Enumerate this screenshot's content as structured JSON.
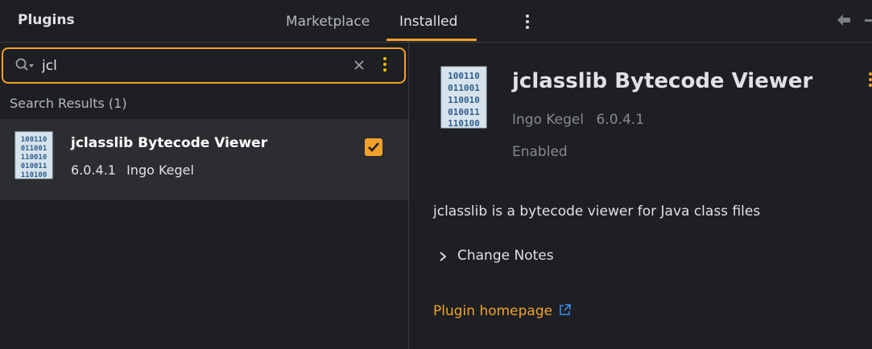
{
  "window": {
    "title": "Plugins"
  },
  "tabs": [
    {
      "label": "Marketplace",
      "active": false
    },
    {
      "label": "Installed",
      "active": true
    }
  ],
  "icons": {
    "options": "more-vertical-icon",
    "back": "back-arrow-icon",
    "search": "search-icon",
    "clear": "close-icon",
    "plugin": "binary-file-icon",
    "expand": "chevron-right-icon",
    "external": "external-link-icon"
  },
  "colors": {
    "accent": "#f0a12c",
    "background": "#1e1f22",
    "selected_row": "#2b2d30"
  },
  "search": {
    "value": "jcl"
  },
  "results": {
    "label": "Search Results (1)",
    "items": [
      {
        "name": "jclasslib Bytecode Viewer",
        "version": "6.0.4.1",
        "vendor": "Ingo Kegel",
        "enabled": true
      }
    ]
  },
  "detail": {
    "name": "jclasslib Bytecode Viewer",
    "vendor": "Ingo Kegel",
    "version": "6.0.4.1",
    "status": "Enabled",
    "description": "jclasslib is a bytecode viewer for Java class files",
    "change_notes_label": "Change Notes",
    "homepage_label": "Plugin homepage"
  }
}
